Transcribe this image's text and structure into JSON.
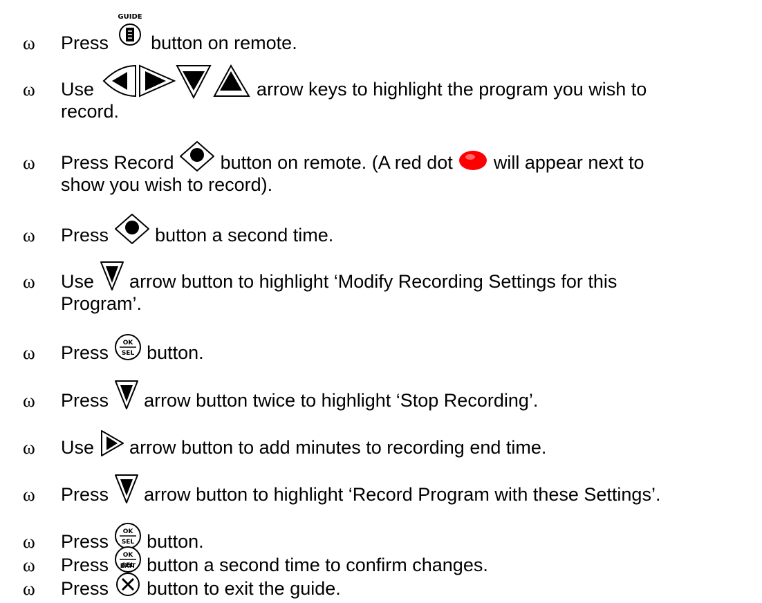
{
  "bullet": "ω",
  "icon_labels": {
    "guide": "GUIDE",
    "ok": "OK",
    "sel": "SEL",
    "exit": "EXIT"
  },
  "steps": [
    {
      "parts": [
        "Press",
        "button on remote."
      ]
    },
    {
      "parts": [
        "Use",
        "arrow keys to highlight the program you wish to",
        "record."
      ]
    },
    {
      "parts": [
        "Press Record",
        "button on remote. (A red dot",
        "will appear next to",
        "show you wish to record)."
      ]
    },
    {
      "parts": [
        "Press",
        "button a second time."
      ]
    },
    {
      "parts": [
        "Use",
        "arrow button to highlight ‘Modify Recording Settings for this",
        "Program’."
      ]
    },
    {
      "parts": [
        "Press",
        "button."
      ]
    },
    {
      "parts": [
        "Press",
        "arrow button twice to highlight ‘Stop Recording’."
      ]
    },
    {
      "parts": [
        "Use",
        "arrow button to add minutes to recording end time."
      ]
    },
    {
      "parts": [
        "Press",
        "arrow button to highlight ‘Record Program with these Settings’."
      ]
    },
    {
      "parts": [
        "Press",
        "button."
      ]
    },
    {
      "parts": [
        "Press",
        "button a second time to confirm changes."
      ]
    },
    {
      "parts": [
        "Press",
        "button to exit the guide."
      ]
    }
  ]
}
